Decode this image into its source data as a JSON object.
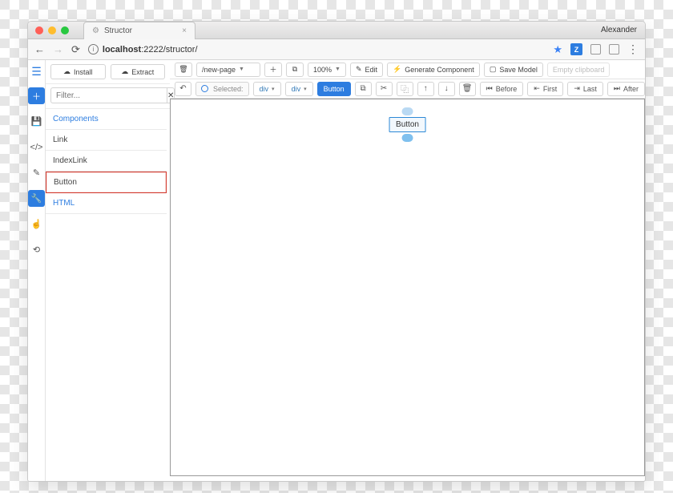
{
  "os": {
    "user": "Alexander"
  },
  "browser": {
    "tab_title": "Structor",
    "url_display": "localhost:2222/structor/",
    "url_host": "localhost",
    "url_port_path": ":2222/structor/"
  },
  "toolbar": {
    "install": "Install",
    "extract": "Extract",
    "route": "/new-page",
    "zoom": "100%",
    "edit": "Edit",
    "generate": "Generate Component",
    "save": "Save Model",
    "clipboard": "Empty clipboard"
  },
  "selection_bar": {
    "selected_label": "Selected:",
    "crumb1": "div",
    "crumb2": "div",
    "crumb3": "Button",
    "before": "Before",
    "first": "First",
    "last": "Last",
    "after": "After"
  },
  "sidebar": {
    "install": "Install",
    "extract": "Extract",
    "filter_placeholder": "Filter...",
    "groups": [
      {
        "title": "Components",
        "items": [
          "Link",
          "IndexLink",
          "Button"
        ],
        "selected": "Button"
      }
    ],
    "html_group": "HTML"
  },
  "canvas": {
    "button_label": "Button"
  }
}
